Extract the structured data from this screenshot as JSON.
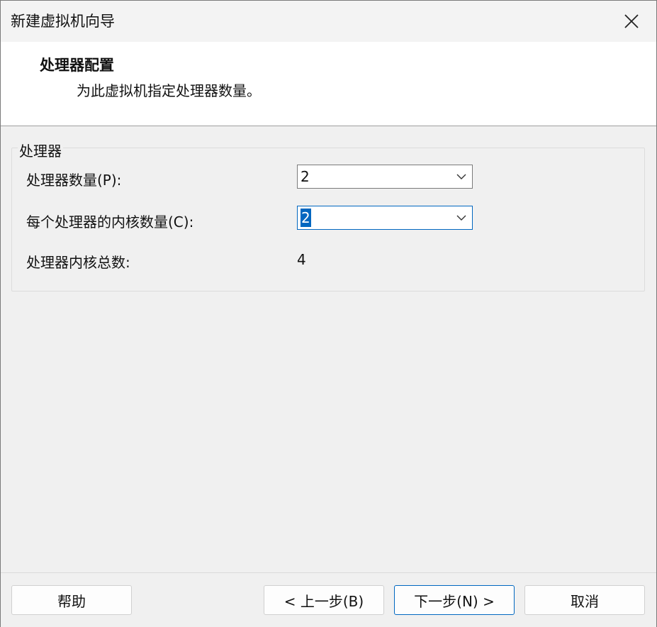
{
  "window": {
    "title": "新建虚拟机向导",
    "close_icon": "close-icon"
  },
  "header": {
    "title": "处理器配置",
    "subtitle": "为此虚拟机指定处理器数量。"
  },
  "processor_group": {
    "legend": "处理器",
    "processor_count": {
      "label": "处理器数量(P):",
      "value": "2"
    },
    "cores_per_processor": {
      "label": "每个处理器的内核数量(C):",
      "value": "2"
    },
    "total_cores": {
      "label": "处理器内核总数:",
      "value": "4"
    }
  },
  "footer": {
    "help_label": "帮助",
    "back_label": "< 上一步(B)",
    "next_label": "下一步(N) >",
    "cancel_label": "取消"
  },
  "colors": {
    "accent": "#0067c0",
    "header_bg": "#ffffff",
    "dialog_bg": "#f0f0f0"
  }
}
